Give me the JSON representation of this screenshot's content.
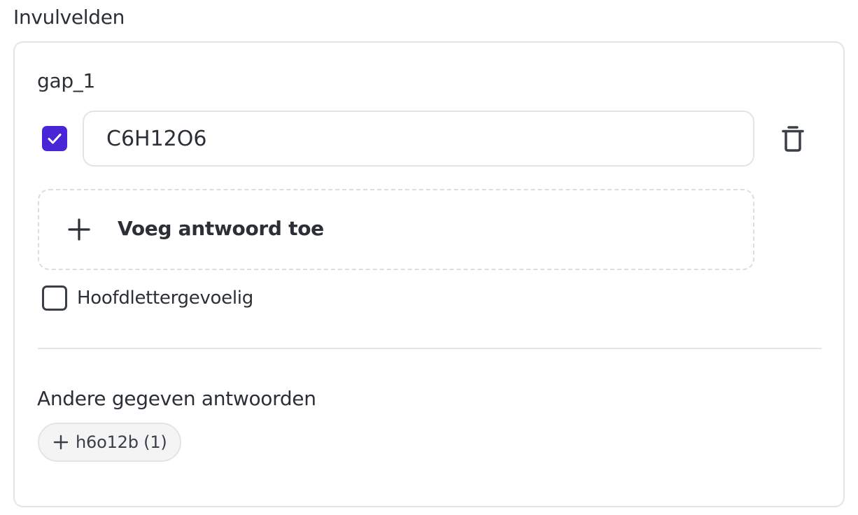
{
  "section": {
    "title": "Invulvelden"
  },
  "gap": {
    "label": "gap_1",
    "answers": [
      {
        "value": "C6H12O6",
        "correct": true
      }
    ],
    "add_answer_label": "Voeg antwoord toe",
    "case_sensitive": {
      "label": "Hoofdlettergevoelig",
      "checked": false
    }
  },
  "other_answers": {
    "title": "Andere gegeven antwoorden",
    "chips": [
      {
        "label": "h6o12b (1)"
      }
    ]
  },
  "colors": {
    "accent": "#4a25d8",
    "text": "#2b2f36",
    "border": "#e3e4e8",
    "chip_bg": "#f4f4f5"
  },
  "icons": {
    "check": "checkmark-icon",
    "delete": "trash-icon",
    "add": "plus-icon"
  }
}
